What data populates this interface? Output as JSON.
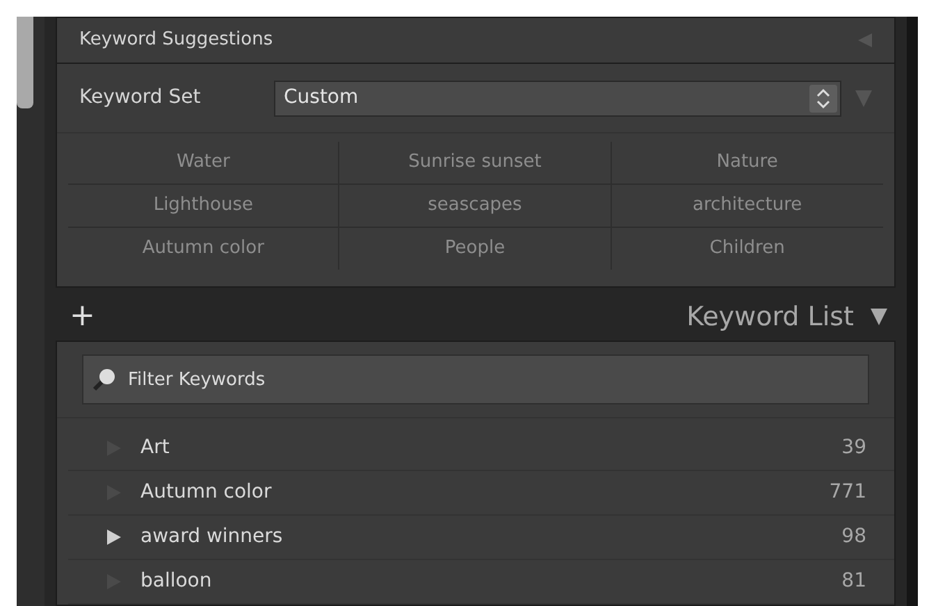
{
  "suggestions_panel": {
    "title": "Keyword Suggestions",
    "expanded": false
  },
  "keyword_set": {
    "label": "Keyword Set",
    "value": "Custom"
  },
  "suggestions": [
    [
      "Water",
      "Sunrise sunset",
      "Nature"
    ],
    [
      "Lighthouse",
      "seascapes",
      "architecture"
    ],
    [
      "Autumn color",
      "People",
      "Children"
    ]
  ],
  "keyword_list_panel": {
    "title": "Keyword List",
    "add": "+",
    "expanded": true
  },
  "filter": {
    "placeholder": "Filter Keywords"
  },
  "keywords": [
    {
      "name": "Art",
      "count": "39",
      "has_children": false
    },
    {
      "name": "Autumn color",
      "count": "771",
      "has_children": false
    },
    {
      "name": "award winners",
      "count": "98",
      "has_children": true
    },
    {
      "name": "balloon",
      "count": "81",
      "has_children": false
    }
  ]
}
